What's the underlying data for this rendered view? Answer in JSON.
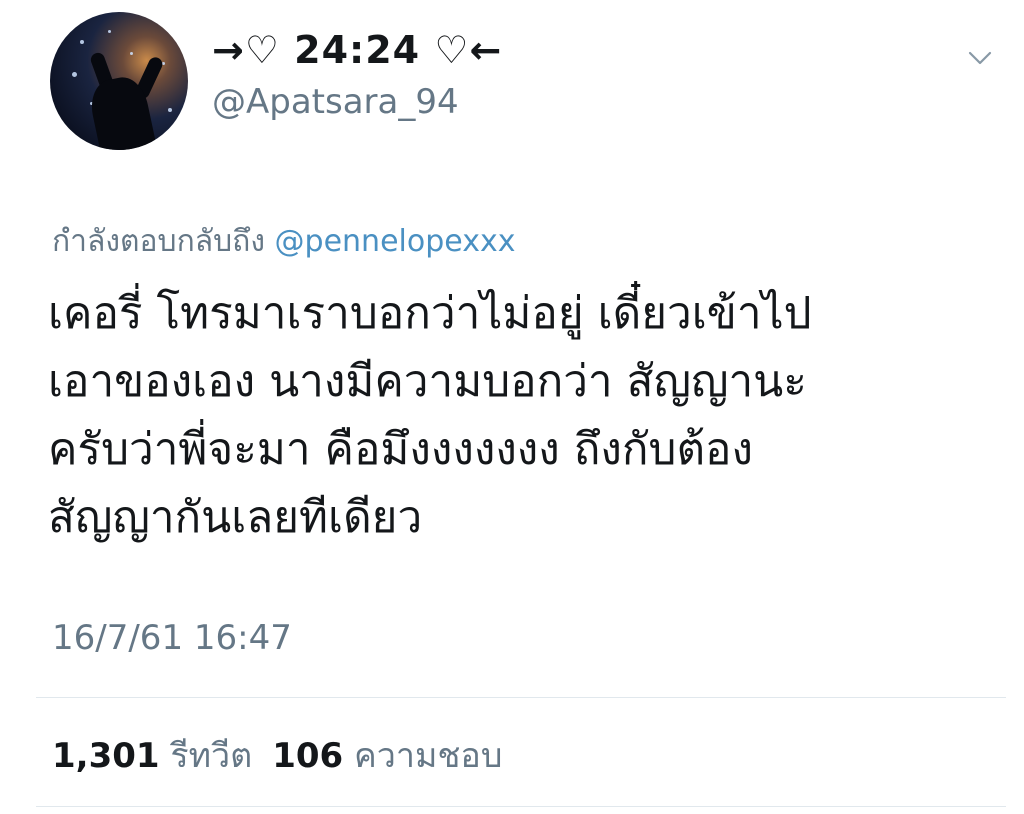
{
  "tweet": {
    "display_name": "→♡ 24:24 ♡←",
    "handle": "@Apatsara_94",
    "reply_prefix": "กำลังตอบกลับถึง",
    "reply_mention": "@pennelopexxx",
    "text_lines": [
      "เคอรี่ โทรมาเราบอกว่าไม่อยู่ เดี๋ยวเข้าไป",
      "เอาของเอง นางมีความบอกว่า สัญญานะ",
      "ครับว่าพี่จะมา คือมึงงงงงงง ถึงกับต้อง",
      "สัญญากันเลยทีเดียว"
    ],
    "timestamp": "16/7/61 16:47",
    "retweets_count": "1,301",
    "retweets_label": "รีทวีต",
    "likes_count": "106",
    "likes_label": "ความชอบ",
    "icons": {
      "avatar": "profile-photo",
      "menu": "chevron-down-icon"
    }
  }
}
